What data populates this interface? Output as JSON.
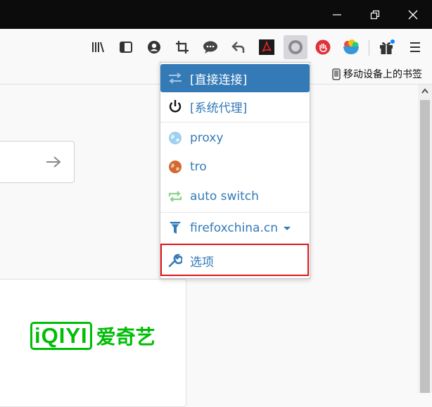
{
  "bookmarks": {
    "mobile_label": "移动设备上的书签"
  },
  "menu": {
    "items": [
      {
        "label": "[直接连接]",
        "icon": "transfer-icon"
      },
      {
        "label": "[系统代理]",
        "icon": "power-icon"
      },
      {
        "label": "proxy",
        "icon": "globe-icon"
      },
      {
        "label": "tro",
        "icon": "globe-icon"
      },
      {
        "label": "auto switch",
        "icon": "switch-icon"
      },
      {
        "label": "firefoxchina.cn",
        "icon": "filter-icon"
      },
      {
        "label": "选项",
        "icon": "wrench-icon"
      }
    ]
  },
  "tile": {
    "brand": "iQIYI",
    "brand_cn": "爱奇艺"
  },
  "colors": {
    "accent": "#337ab7",
    "selected_bg": "#337ab7",
    "highlight_box": "#e0141a",
    "iqiyi_green": "#00be06"
  }
}
